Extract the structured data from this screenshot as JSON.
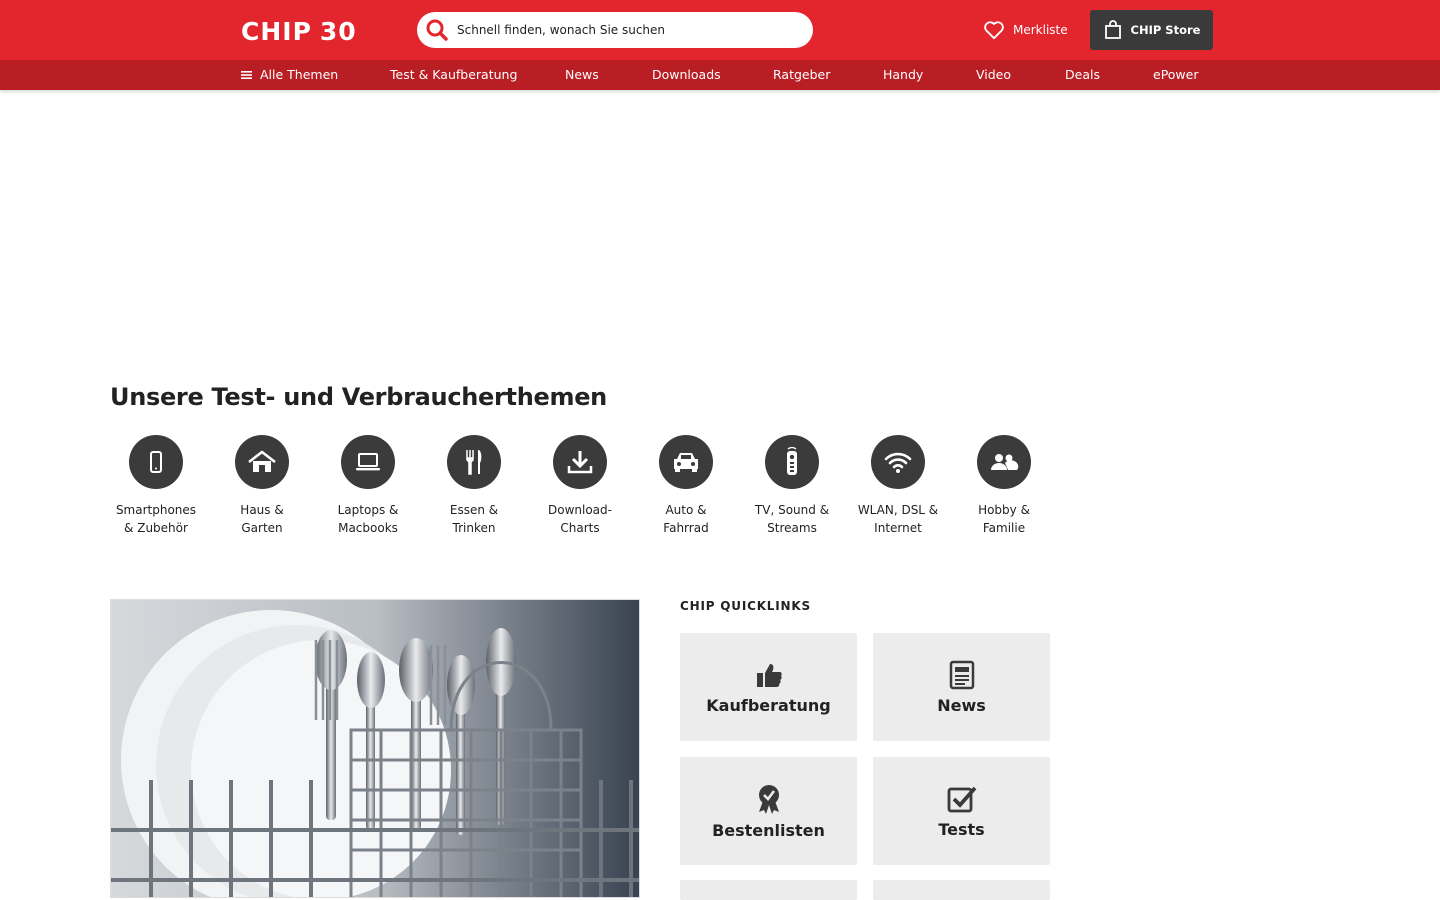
{
  "header": {
    "logo_text": "CHIP",
    "logo_anniversary": "30",
    "search_placeholder": "Schnell finden, wonach Sie suchen",
    "merkliste_label": "Merkliste",
    "store_label": "CHIP Store",
    "brand_color": "#e3262d",
    "nav_color": "#b91e25"
  },
  "nav": {
    "all_topics": "Alle Themen",
    "items": [
      "Test & Kaufberatung",
      "News",
      "Downloads",
      "Ratgeber",
      "Handy",
      "Video",
      "Deals",
      "ePower"
    ]
  },
  "topics": {
    "title": "Unsere Test- und Verbraucherthemen",
    "items": [
      {
        "label": "Smartphones\n& Zubehör",
        "icon": "smartphone-icon"
      },
      {
        "label": "Haus &\nGarten",
        "icon": "house-icon"
      },
      {
        "label": "Laptops &\nMacbooks",
        "icon": "laptop-icon"
      },
      {
        "label": "Essen &\nTrinken",
        "icon": "cutlery-icon"
      },
      {
        "label": "Download-\nCharts",
        "icon": "download-icon"
      },
      {
        "label": "Auto &\nFahrrad",
        "icon": "car-icon"
      },
      {
        "label": "TV, Sound &\nStreams",
        "icon": "remote-icon"
      },
      {
        "label": "WLAN, DSL &\nInternet",
        "icon": "wifi-icon"
      },
      {
        "label": "Hobby &\nFamilie",
        "icon": "family-icon"
      }
    ]
  },
  "quicklinks": {
    "title": "CHIP QUICKLINKS",
    "items": [
      {
        "label": "Kaufberatung",
        "icon": "thumbs-up-icon"
      },
      {
        "label": "News",
        "icon": "newspaper-icon"
      },
      {
        "label": "Bestenlisten",
        "icon": "award-icon"
      },
      {
        "label": "Tests",
        "icon": "checkbox-icon"
      }
    ]
  }
}
